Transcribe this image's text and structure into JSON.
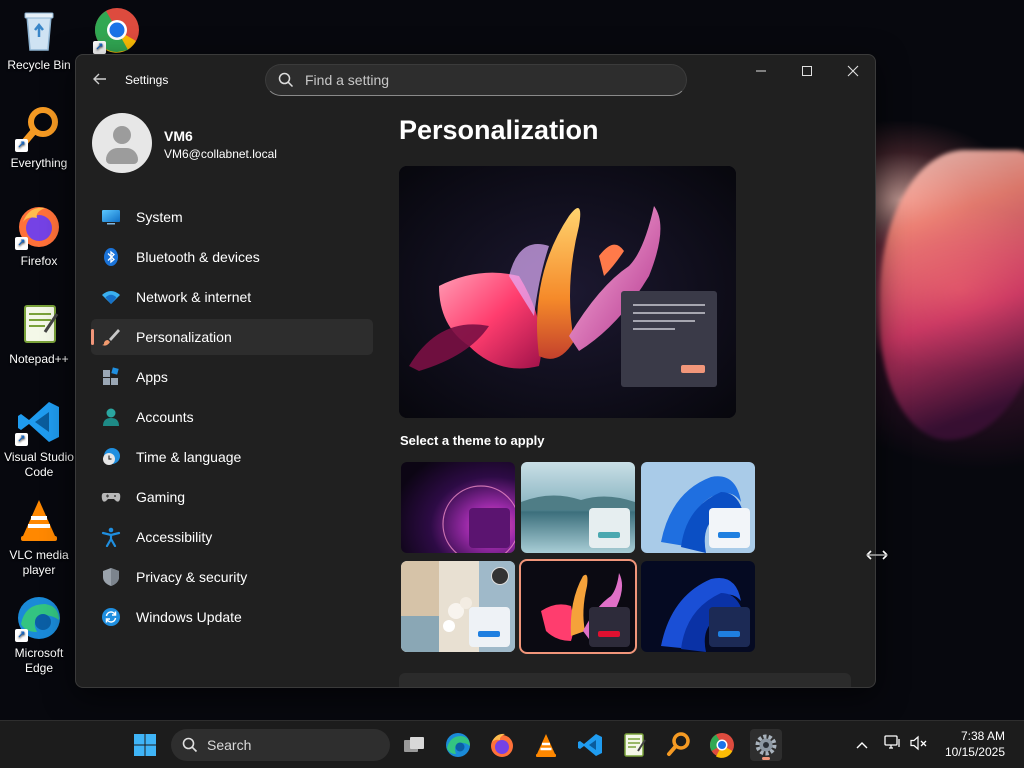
{
  "desktop": {
    "icons": [
      {
        "label": "Recycle Bin"
      },
      {
        "label": "Everything"
      },
      {
        "label": "Firefox"
      },
      {
        "label": "Notepad++"
      },
      {
        "label": "Visual Studio Code"
      },
      {
        "label": "VLC media player"
      },
      {
        "label": "Microsoft Edge"
      }
    ],
    "chrome_icon": "chrome-icon"
  },
  "window": {
    "title": "Settings",
    "search_placeholder": "Find a setting",
    "controls": {
      "minimize": "—",
      "maximize": "☐",
      "close": "✕"
    },
    "user": {
      "name": "VM6",
      "email": "VM6@collabnet.local"
    },
    "nav": [
      {
        "label": "System",
        "icon": "system-icon"
      },
      {
        "label": "Bluetooth & devices",
        "icon": "bluetooth-icon"
      },
      {
        "label": "Network & internet",
        "icon": "wifi-icon"
      },
      {
        "label": "Personalization",
        "icon": "brush-icon",
        "active": true
      },
      {
        "label": "Apps",
        "icon": "apps-icon"
      },
      {
        "label": "Accounts",
        "icon": "accounts-icon"
      },
      {
        "label": "Time & language",
        "icon": "clock-globe-icon"
      },
      {
        "label": "Gaming",
        "icon": "gamepad-icon"
      },
      {
        "label": "Accessibility",
        "icon": "accessibility-icon"
      },
      {
        "label": "Privacy & security",
        "icon": "shield-icon"
      },
      {
        "label": "Windows Update",
        "icon": "update-icon"
      }
    ],
    "main": {
      "title": "Personalization",
      "theme_section_label": "Select a theme to apply",
      "themes": [
        {
          "name": "theme-glow",
          "selected": false
        },
        {
          "name": "theme-captured-motion-lake",
          "selected": false
        },
        {
          "name": "theme-windows-light",
          "selected": false
        },
        {
          "name": "theme-flowers-spotlight",
          "selected": false
        },
        {
          "name": "theme-current-dark-bloom",
          "selected": true
        },
        {
          "name": "theme-windows-dark",
          "selected": false
        }
      ]
    }
  },
  "taskbar": {
    "search_label": "Search",
    "clock_time": "7:38 AM",
    "clock_date": "10/15/2025",
    "accent": "#f1967a"
  }
}
